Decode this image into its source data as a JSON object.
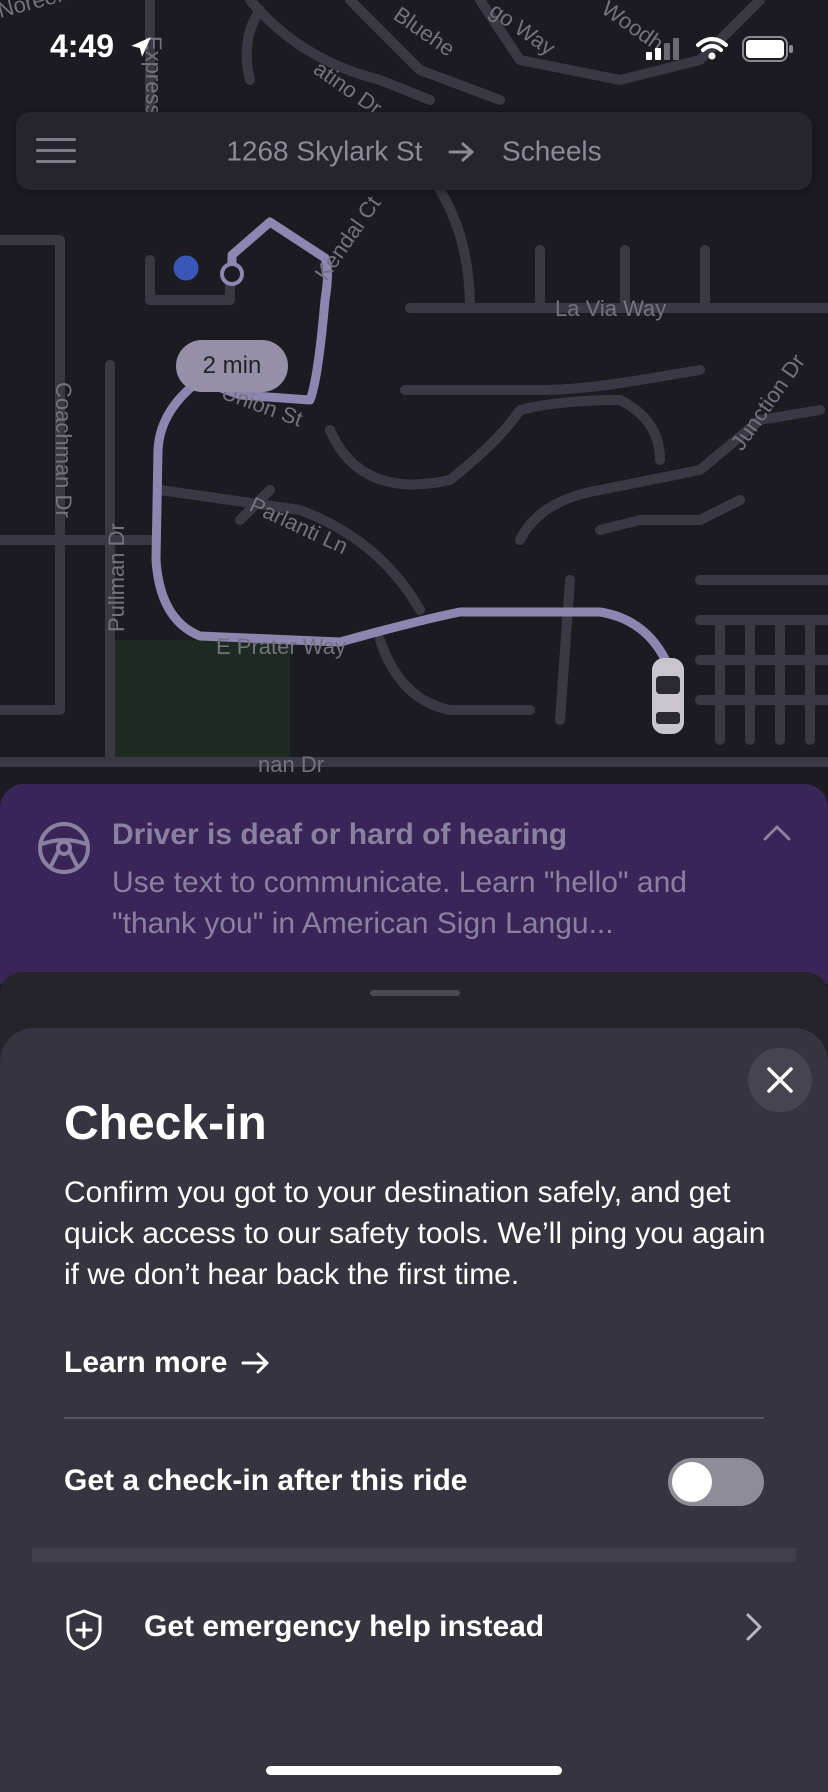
{
  "status_bar": {
    "time": "4:49"
  },
  "top_bar": {
    "origin": "1268 Skylark St",
    "destination": "Scheels"
  },
  "map": {
    "eta": "2 min",
    "street_labels": [
      "Noreen Dr",
      "Bluehe",
      "atino Dr",
      "go Way",
      "Woodh",
      "Express St",
      "Kendal Ct",
      "La Via Way",
      "Coachman Dr",
      "Union St",
      "Junction Dr",
      "Parlanti Ln",
      "Pullman Dr",
      "E Prater Way",
      "nan Dr"
    ]
  },
  "banner": {
    "title": "Driver is deaf or hard of hearing",
    "body": "Use text to communicate. Learn \"hello\" and \"thank you\" in American Sign Langu..."
  },
  "sheet": {
    "title": "Check-in",
    "description": "Confirm you got to your destination safely, and get quick access to our safety tools. We’ll ping you again if we don’t hear back the first time.",
    "learn_more": "Learn more",
    "toggle_label": "Get a check-in after this ride",
    "toggle_on": false,
    "emergency_label": "Get emergency help instead"
  },
  "colors": {
    "map_bg": "#1c1b22",
    "banner_bg": "#3a2558",
    "sheet_bg": "#35343f",
    "route": "#8d86b0"
  }
}
